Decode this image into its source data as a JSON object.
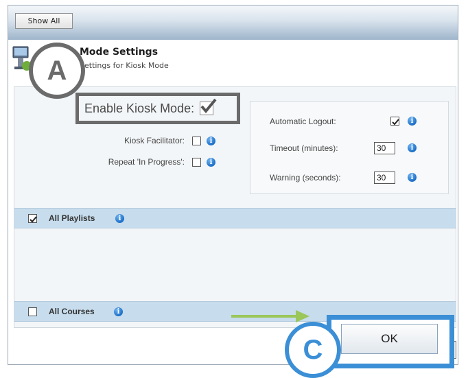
{
  "toolbar": {
    "show_all_label": "Show All"
  },
  "header": {
    "title": "Mode Settings",
    "subtitle": "Settings for Kiosk Mode",
    "icon": "kiosk-computer-icon"
  },
  "enable_kiosk": {
    "label": "Enable Kiosk Mode:",
    "checked": true
  },
  "left_options": [
    {
      "label": "Kiosk Facilitator:",
      "checked": false
    },
    {
      "label": "Repeat 'In Progress':",
      "checked": false
    }
  ],
  "right_panel": {
    "automatic_logout": {
      "label": "Automatic Logout:",
      "checked": true
    },
    "timeout": {
      "label": "Timeout (minutes):",
      "value": "30"
    },
    "warning": {
      "label": "Warning (seconds):",
      "value": "30"
    }
  },
  "sections": {
    "playlists": {
      "label": "All Playlists",
      "checked": true
    },
    "courses": {
      "label": "All Courses",
      "checked": false
    }
  },
  "footer": {
    "ok_label": "OK"
  },
  "annotations": {
    "a": "A",
    "c": "C"
  },
  "colors": {
    "accent_blue": "#3b8fd6",
    "annotation_gray": "#6b6b6b",
    "section_bar": "#c7dcec",
    "arrow_green": "#9ac65a",
    "info_blue": "#1b6fc7"
  }
}
